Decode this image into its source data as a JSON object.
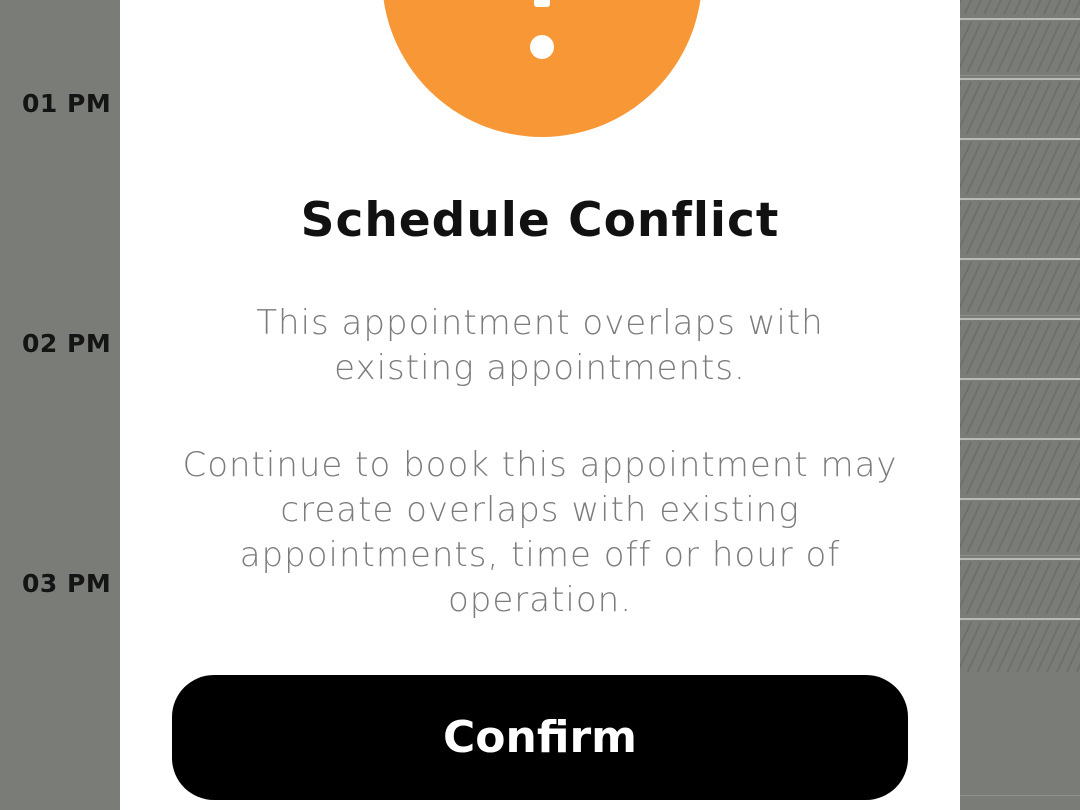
{
  "calendar": {
    "time_labels": [
      "01 PM",
      "02 PM",
      "03 PM"
    ]
  },
  "modal": {
    "icon": "alert-exclamation-icon",
    "accent_color": "#f79736",
    "title": "Schedule Conflict",
    "message_lines_1": [
      "This appointment overlaps with",
      "existing appointments."
    ],
    "message_lines_2": [
      "Continue to book this appointment may",
      "create overlaps with existing",
      "appointments, time off or hour of",
      "operation."
    ],
    "confirm_label": "Confirm"
  }
}
